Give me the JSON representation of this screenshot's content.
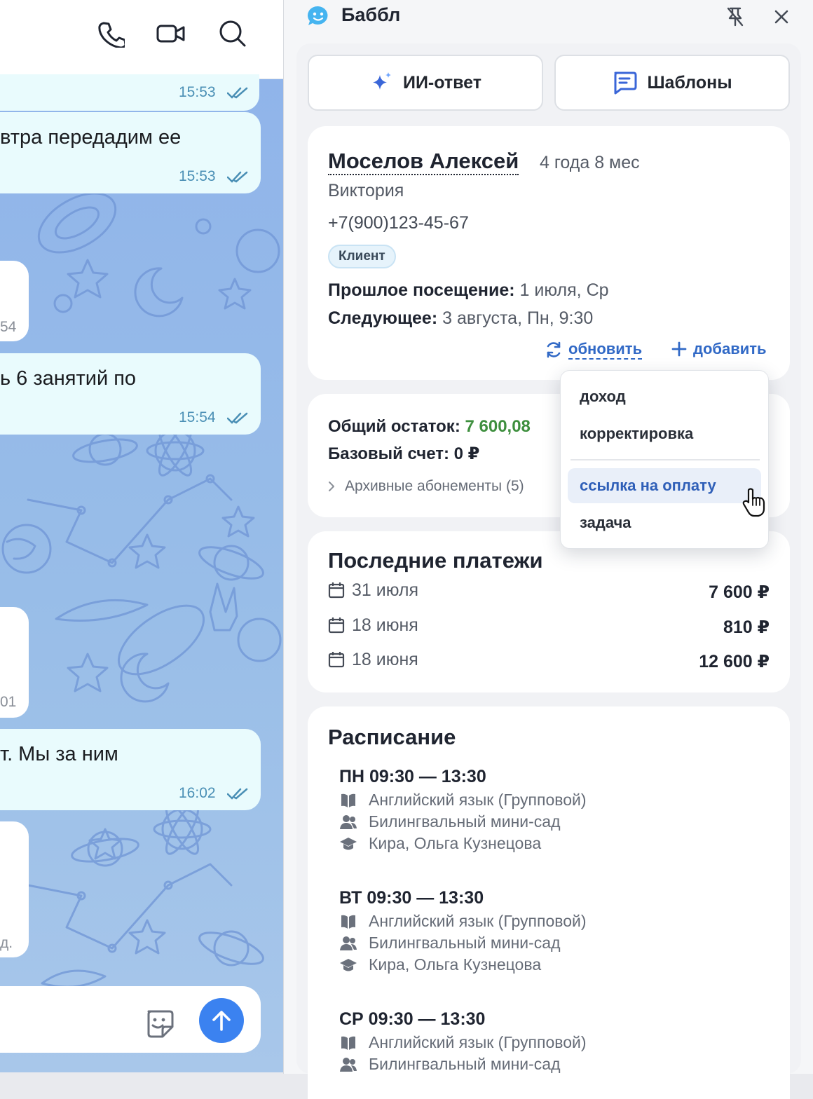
{
  "chat": {
    "messages": [
      {
        "text": "",
        "time": "15:53"
      },
      {
        "text": "втра передадим ее",
        "time": "15:53"
      },
      {
        "text": "ь 6 занятий по",
        "time": "15:54"
      },
      {
        "text": "т. Мы за ним",
        "time": "16:02"
      }
    ],
    "incoming_fragments": [
      "54",
      "01",
      "д."
    ]
  },
  "panel": {
    "title": "Баббл",
    "ai_reply_label": "ИИ-ответ",
    "templates_label": "Шаблоны"
  },
  "client": {
    "name": "Моселов Алексей",
    "age": "4 года 8 мес",
    "parent": "Виктория",
    "phone": "+7(900)123-45-67",
    "tag": "Клиент",
    "last_visit_label": "Прошлое посещение:",
    "last_visit_value": "1 июля, Ср",
    "next_visit_label": "Следующее:",
    "next_visit_value": "3 августа, Пн, 9:30",
    "refresh_label": "обновить",
    "add_label": "добавить"
  },
  "balance": {
    "total_label": "Общий остаток:",
    "total_value": "7 600,08",
    "base_label": "Базовый счет: 0 ₽",
    "archived_label": "Архивные абонементы (5)"
  },
  "dropdown": {
    "items": [
      "доход",
      "корректировка",
      "ссылка на оплату",
      "задача"
    ],
    "active_index": 2
  },
  "payments": {
    "title": "Последние платежи",
    "rows": [
      {
        "date": "31 июля",
        "amount": "7 600 ₽"
      },
      {
        "date": "18 июня",
        "amount": "810 ₽"
      },
      {
        "date": "18 июня",
        "amount": "12 600 ₽"
      }
    ]
  },
  "schedule": {
    "title": "Расписание",
    "entries": [
      {
        "time": "ПН 09:30 — 13:30",
        "subject": "Английский язык (Групповой)",
        "group": "Билингвальный мини-сад",
        "teacher": "Кира, Ольга Кузнецова"
      },
      {
        "time": "ВТ 09:30 — 13:30",
        "subject": "Английский язык (Групповой)",
        "group": "Билингвальный мини-сад",
        "teacher": "Кира, Ольга Кузнецова"
      },
      {
        "time": "СР 09:30 — 13:30",
        "subject": "Английский язык (Групповой)",
        "group": "Билингвальный мини-сад"
      }
    ]
  },
  "colors": {
    "accent": "#3b82f0",
    "link": "#3169c6",
    "positive": "#3e8f3e",
    "chat_bubble": "#e9fbfd"
  }
}
